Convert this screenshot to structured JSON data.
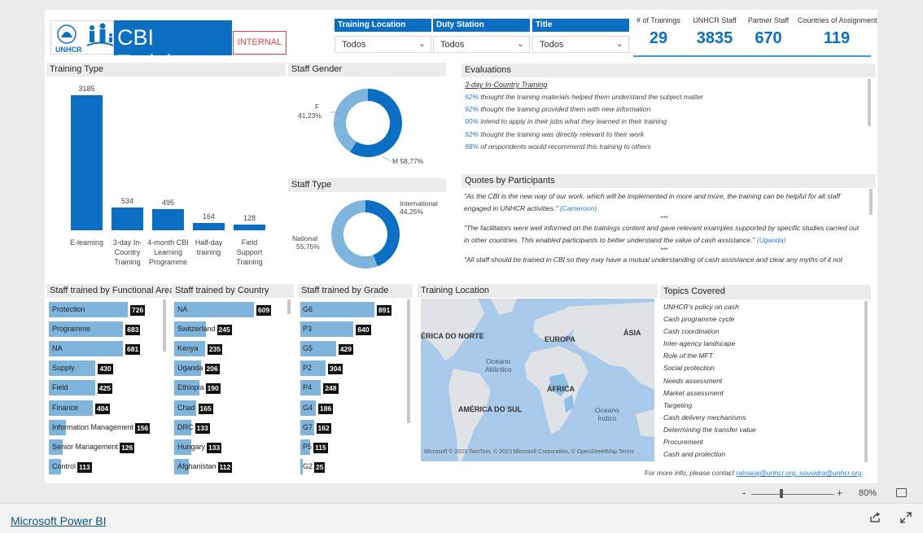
{
  "header": {
    "org": "UNHCR",
    "title": "CBI Training",
    "badge": "INTERNAL"
  },
  "filters": [
    {
      "label": "Training Location",
      "value": "Todos"
    },
    {
      "label": "Duty Station",
      "value": "Todos"
    },
    {
      "label": "Title",
      "value": "Todos"
    }
  ],
  "kpis": [
    {
      "label": "# of Trainings",
      "value": "29"
    },
    {
      "label": "UNHCR Staff",
      "value": "3835"
    },
    {
      "label": "Partner Staff",
      "value": "670"
    },
    {
      "label": "Countries of Assignment",
      "value": "119"
    }
  ],
  "panels": {
    "training_type": "Training Type",
    "staff_gender": "Staff Gender",
    "staff_type": "Staff Type",
    "evaluations": "Evaluations",
    "quotes": "Quotes by Participants",
    "by_area": "Staff trained by Functional Area",
    "by_country": "Staff trained by Country",
    "by_grade": "Staff trained by Grade",
    "location": "Training Location",
    "topics": "Topics Covered"
  },
  "chart_data": [
    {
      "type": "bar",
      "categories": [
        "E-learning",
        "3-day In-Country Training",
        "4-month CBI Learning Programme",
        "Half-day training",
        "Field Support Training"
      ],
      "values": [
        3185,
        534,
        495,
        164,
        128
      ]
    },
    {
      "type": "pie",
      "labels": [
        "F",
        "M"
      ],
      "values": [
        41.23,
        58.77
      ],
      "display": [
        "41,23%",
        "M 58,77%"
      ]
    },
    {
      "type": "pie",
      "labels": [
        "International",
        "National"
      ],
      "values": [
        44.25,
        55.75
      ],
      "display": [
        "44,25%",
        "55,75%"
      ]
    },
    {
      "type": "bar",
      "categories": [
        "Protection",
        "Programme",
        "NA",
        "Supply",
        "Field",
        "Finance",
        "Information Management",
        "Senior Management",
        "Control"
      ],
      "values": [
        726,
        683,
        681,
        430,
        425,
        404,
        156,
        126,
        113
      ]
    },
    {
      "type": "bar",
      "categories": [
        "NA",
        "Switzerland",
        "Kenya",
        "Uganda",
        "Ethiopia",
        "Chad",
        "DRC",
        "Hungary",
        "Afghanistan"
      ],
      "values": [
        609,
        245,
        235,
        206,
        190,
        165,
        133,
        133,
        112
      ]
    },
    {
      "type": "bar",
      "categories": [
        "G6",
        "P3",
        "G5",
        "P2",
        "P4",
        "G4",
        "G7",
        "P5",
        "G2"
      ],
      "values": [
        891,
        640,
        429,
        304,
        248,
        186,
        162,
        115,
        25
      ]
    }
  ],
  "evaluations": {
    "heading": "3-day In-Country Training",
    "lines": [
      {
        "pct": "92%",
        "text": "thought the training materials helped them understand the subject matter"
      },
      {
        "pct": "92%",
        "text": "thought the training provided them with new information"
      },
      {
        "pct": "90%",
        "text": "intend to apply in their jobs what they learned in their training"
      },
      {
        "pct": "92%",
        "text": "thought the training was directly relevant to their work"
      },
      {
        "pct": "98%",
        "text": "of respondents would recommend this training to others"
      }
    ]
  },
  "quotes": {
    "q1": "\"As the CBI is the new way of our work, which will be implemented in more and more, the training can be helpful for all staff engaged in UNHCR activities.\"",
    "q1_src": "(Cameroon)",
    "sep": "***",
    "q2": "\"The facilitators were well informed on the trainings content and gave relevant examples supported by specific studies carried out in other countries. This enabled participants to better understand the value of cash assistance.\"",
    "q2_src": "(Uganda)",
    "q3": "\"All staff should be trained in CBI so they may have a mutual understanding of cash assistance and clear any myths of it not"
  },
  "map": {
    "labels": [
      "ÉRICA DO NORTE",
      "EUROPA",
      "ÁSIA",
      "ÁFRICA",
      "AMÉRICA DO SUL",
      "Oceano Atlântico",
      "Oceano Índico"
    ],
    "credit": "Microsoft",
    "credit_text": "© 2023 TomTom, © 2023 Microsoft Corporation, © OpenStreetMap  Terms"
  },
  "topics": [
    "UNHCR's policy on cash",
    "Cash programme cycle",
    "Cash coordination",
    "Inter-agency landscape",
    "Role of the MFT",
    "Social protection",
    "Needs assessment",
    "Market assessment",
    "Targeting",
    "Cash delivery mechanisms",
    "Determining the transfer value",
    "Procurement",
    "Cash and protection"
  ],
  "contact": {
    "text": "For more info, please contact",
    "emails": "ratnaraj@unhcr.org, souvidra@unhcr.org"
  },
  "zoom": {
    "minus": "-",
    "plus": "+",
    "value": "80%"
  },
  "footer": {
    "link": "Microsoft Power BI"
  },
  "colors": {
    "primary": "#0a6fc2",
    "light": "#7fb4dc",
    "alert": "#e0404b"
  }
}
